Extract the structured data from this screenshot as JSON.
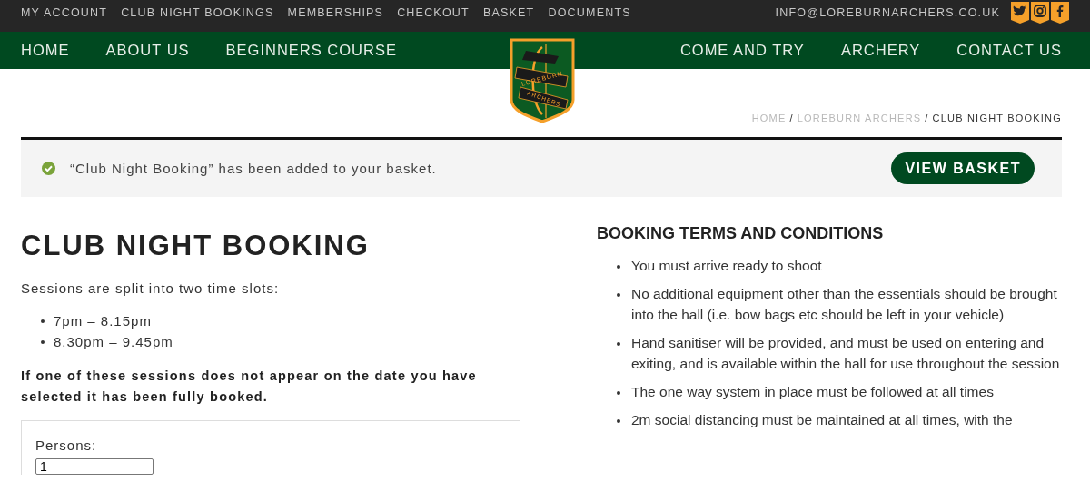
{
  "top_bar": {
    "links": [
      "MY ACCOUNT",
      "CLUB NIGHT BOOKINGS",
      "MEMBERSHIPS",
      "CHECKOUT",
      "BASKET",
      "DOCUMENTS"
    ],
    "email": "INFO@LOREBURNARCHERS.CO.UK",
    "social": [
      {
        "kind": "twitter"
      },
      {
        "kind": "instagram"
      },
      {
        "kind": "facebook"
      }
    ]
  },
  "main_nav": {
    "left": [
      "HOME",
      "ABOUT US",
      "BEGINNERS COURSE"
    ],
    "right": [
      "COME AND TRY",
      "ARCHERY",
      "CONTACT US"
    ]
  },
  "logo": {
    "top_text": "LOREBURN",
    "bottom_text": "ARCHERS"
  },
  "breadcrumb": {
    "separator": "/",
    "items": [
      {
        "label": "HOME",
        "current": false
      },
      {
        "label": "LOREBURN ARCHERS",
        "current": false
      },
      {
        "label": "CLUB NIGHT BOOKING",
        "current": true
      }
    ]
  },
  "notice": {
    "message": "“Club Night Booking” has been added to your basket.",
    "button": "VIEW BASKET"
  },
  "booking": {
    "title": "CLUB NIGHT BOOKING",
    "intro": "Sessions are split into two time slots:",
    "slots": [
      "7pm – 8.15pm",
      "8.30pm – 9.45pm"
    ],
    "warning": "If one of these sessions does not appear on the date you have selected it has been fully booked.",
    "persons_label": "Persons:",
    "persons_value": "1"
  },
  "terms": {
    "title": "BOOKING TERMS AND CONDITIONS",
    "items": [
      "You must arrive ready to shoot",
      "No additional equipment other than the essentials should be brought into the hall (i.e. bow bags etc should be left in your vehicle)",
      "Hand sanitiser will be provided, and must be used on entering and exiting, and is available within the hall for use throughout the session",
      "The one way system in place must be followed at all times",
      "2m social distancing must be maintained at all times, with the"
    ]
  }
}
